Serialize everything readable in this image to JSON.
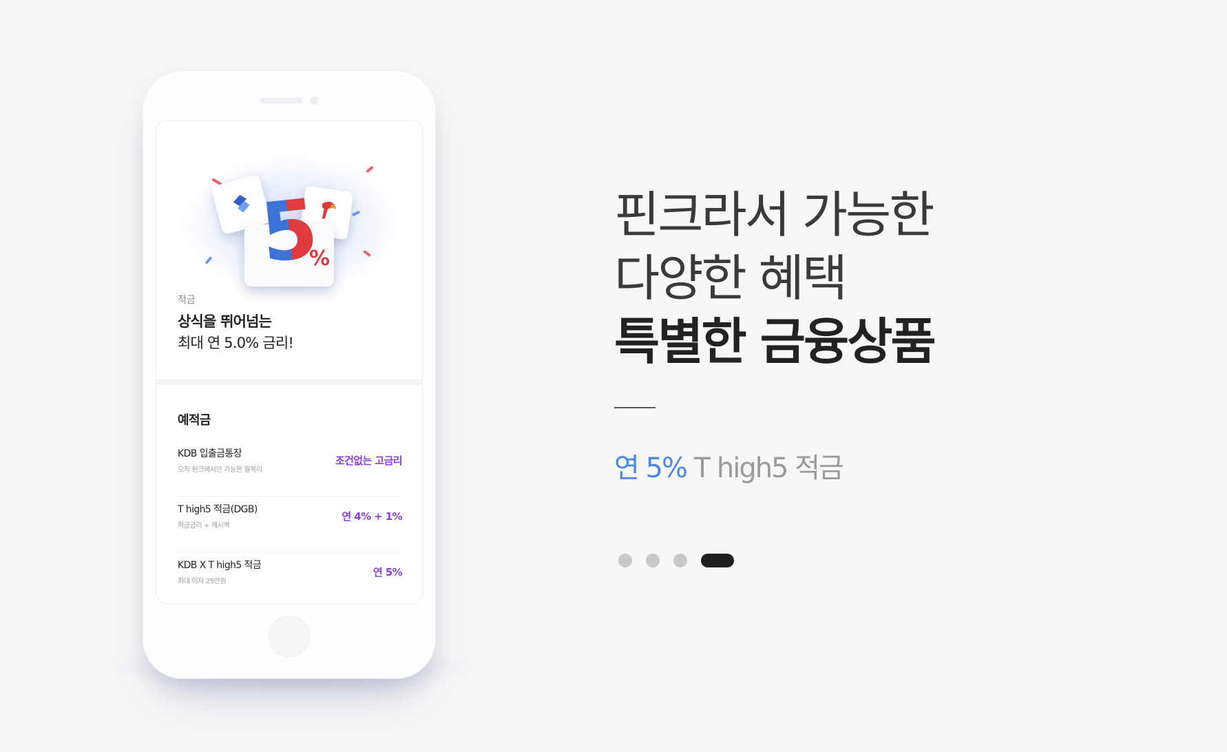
{
  "phone": {
    "card": {
      "badge_percent": "5",
      "badge_percent_sign": "%",
      "category": "적금",
      "title_line1": "상식을 뛰어넘는",
      "title_line2": "최대 연 5.0% 금리!"
    },
    "section": {
      "title": "예적금",
      "products": [
        {
          "name": "KDB 입출금통장",
          "desc": "오직 핀크에서만 가능한 월복리",
          "rate": "조건없는 고금리"
        },
        {
          "name": "T high5 적금(DGB)",
          "desc": "적금금리 + 캐시백",
          "rate": "연 4% + 1%"
        },
        {
          "name": "KDB X T high5 적금",
          "desc": "최대 이자 25만원",
          "rate": "연 5%"
        }
      ]
    }
  },
  "headline": {
    "line1": "핀크라서 가능한",
    "line2": "다양한 혜택",
    "line3": "특별한 금융상품"
  },
  "subtitle": {
    "highlight": "연 5%",
    "rest": " T high5 적금"
  },
  "carousel": {
    "total": 4,
    "active_index": 3
  },
  "colors": {
    "accent_blue": "#4a87e6",
    "rate_purple": "#8a3fe0",
    "background": "#f7f7f7"
  }
}
